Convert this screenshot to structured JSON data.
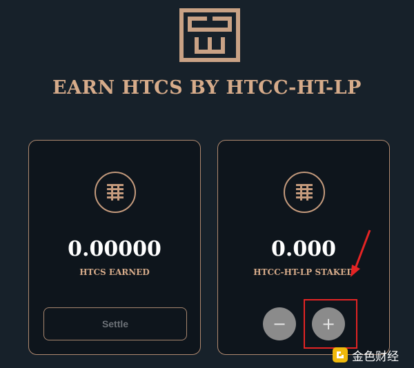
{
  "page": {
    "title": "EARN HTCS BY HTCC-HT-LP"
  },
  "cards": [
    {
      "value": "0.00000",
      "label": "HTCS EARNED",
      "button_label": "Settle"
    },
    {
      "value": "0.000",
      "label": "HTCC-HT-LP STAKED",
      "minus_label": "−",
      "plus_label": "+"
    }
  ],
  "watermark": {
    "text": "金色财经"
  },
  "colors": {
    "background": "#17212a",
    "accent": "#d6ab8a",
    "annotation": "#e52424",
    "button_gray": "#8b8b8b"
  },
  "icons": {
    "logo": "htc-logo-icon",
    "coin": "coin-icon",
    "arrow": "annotation-arrow-icon"
  }
}
